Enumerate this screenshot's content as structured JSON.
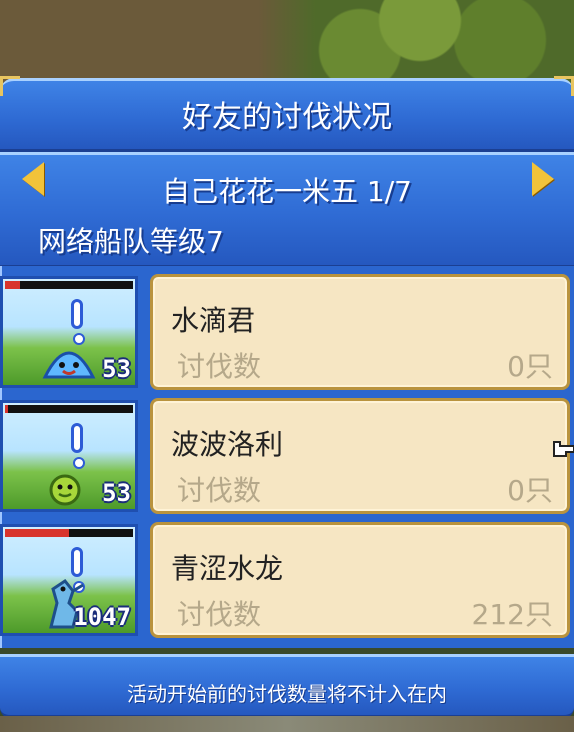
{
  "dialog": {
    "title": "好友的讨伐状况",
    "nav_label": "自己花花一米五 1/7",
    "fleet_level": "网络船队等级7",
    "footer_note": "活动开始前的讨伐数量将不计入在内"
  },
  "rows": [
    {
      "name": "水滴君",
      "count_label": "讨伐数",
      "count": "0只",
      "level": "53",
      "hp_fraction": 0.12,
      "hp_color": "#d8342c",
      "monster_icon": "blue-slime-icon"
    },
    {
      "name": "波波洛利",
      "count_label": "讨伐数",
      "count": "0只",
      "level": "53",
      "hp_fraction": 0.02,
      "hp_color": "#d8342c",
      "monster_icon": "green-blob-icon"
    },
    {
      "name": "青涩水龙",
      "count_label": "讨伐数",
      "count": "212只",
      "level": "1047",
      "hp_fraction": 0.5,
      "hp_color": "#d8342c",
      "monster_icon": "water-dragon-icon"
    }
  ],
  "colors": {
    "panel_blue": "#2f6bd4",
    "card_bg": "#f6e6c3",
    "arrow_gold": "#f2c33a"
  }
}
